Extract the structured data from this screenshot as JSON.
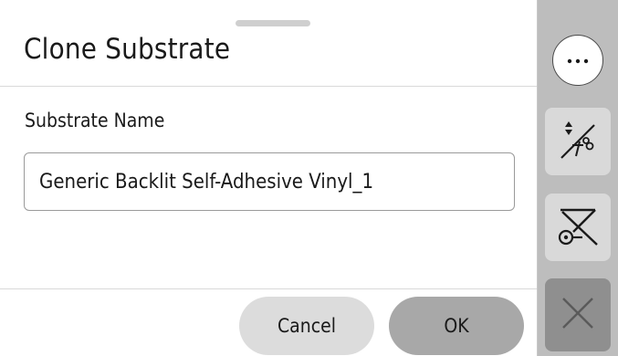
{
  "dialog": {
    "title": "Clone Substrate",
    "field_label": "Substrate Name",
    "field_value": "Generic Backlit Self-Adhesive Vinyl_1",
    "cancel_label": "Cancel",
    "ok_label": "OK"
  },
  "side_panel": {
    "items": [
      {
        "icon": "more-options-icon"
      },
      {
        "icon": "advance-cut-icon"
      },
      {
        "icon": "unload-substrate-icon"
      },
      {
        "icon": "close-icon"
      }
    ]
  },
  "colors": {
    "side_panel_bg": "#bdbdbd",
    "cancel_button_bg": "#dcdcdc",
    "ok_button_bg": "#a8a8a8",
    "close_button_bg": "#8f8f8f"
  }
}
